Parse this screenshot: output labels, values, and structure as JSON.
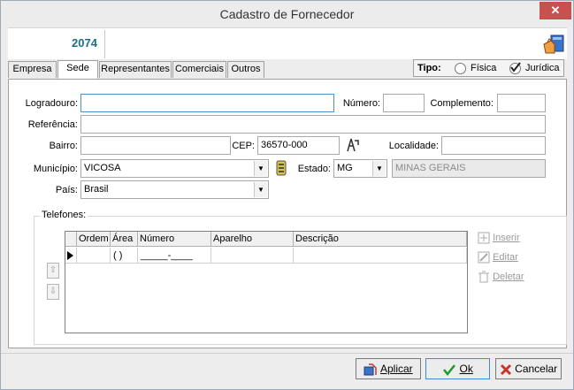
{
  "window": {
    "title": "Cadastro de Fornecedor",
    "close": "✕"
  },
  "header": {
    "code": "2074"
  },
  "tabs": [
    {
      "label": "Empresa"
    },
    {
      "label": "Sede"
    },
    {
      "label": "Representantes"
    },
    {
      "label": "Comerciais"
    },
    {
      "label": "Outros"
    }
  ],
  "tipo": {
    "label": "Tipo:",
    "fisica": "Física",
    "juridica": "Jurídica",
    "selected": "Jurídica"
  },
  "form": {
    "logradouro_label": "Logradouro:",
    "logradouro_value": "",
    "numero_label": "Número:",
    "numero_value": "",
    "complemento_label": "Complemento:",
    "complemento_value": "",
    "referencia_label": "Referência:",
    "referencia_value": "",
    "bairro_label": "Bairro:",
    "bairro_value": "",
    "cep_label": "CEP:",
    "cep_value": "36570-000",
    "localidade_label": "Localidade:",
    "localidade_value": "",
    "municipio_label": "Município:",
    "municipio_value": "VICOSA",
    "estado_label": "Estado:",
    "estado_value": "MG",
    "estado_nome": "MINAS GERAIS",
    "pais_label": "País:",
    "pais_value": "Brasil"
  },
  "telefones": {
    "title": "Telefones:",
    "columns": [
      "Ordem",
      "Área",
      "Número",
      "Aparelho",
      "Descrição"
    ],
    "row": [
      "",
      "(  )",
      "_____-____",
      "",
      ""
    ],
    "actions": {
      "inserir": "Inserir",
      "editar": "Editar",
      "deletar": "Deletar"
    }
  },
  "footer": {
    "aplicar": "Aplicar",
    "ok": "Ok",
    "cancelar": "Cancelar"
  }
}
